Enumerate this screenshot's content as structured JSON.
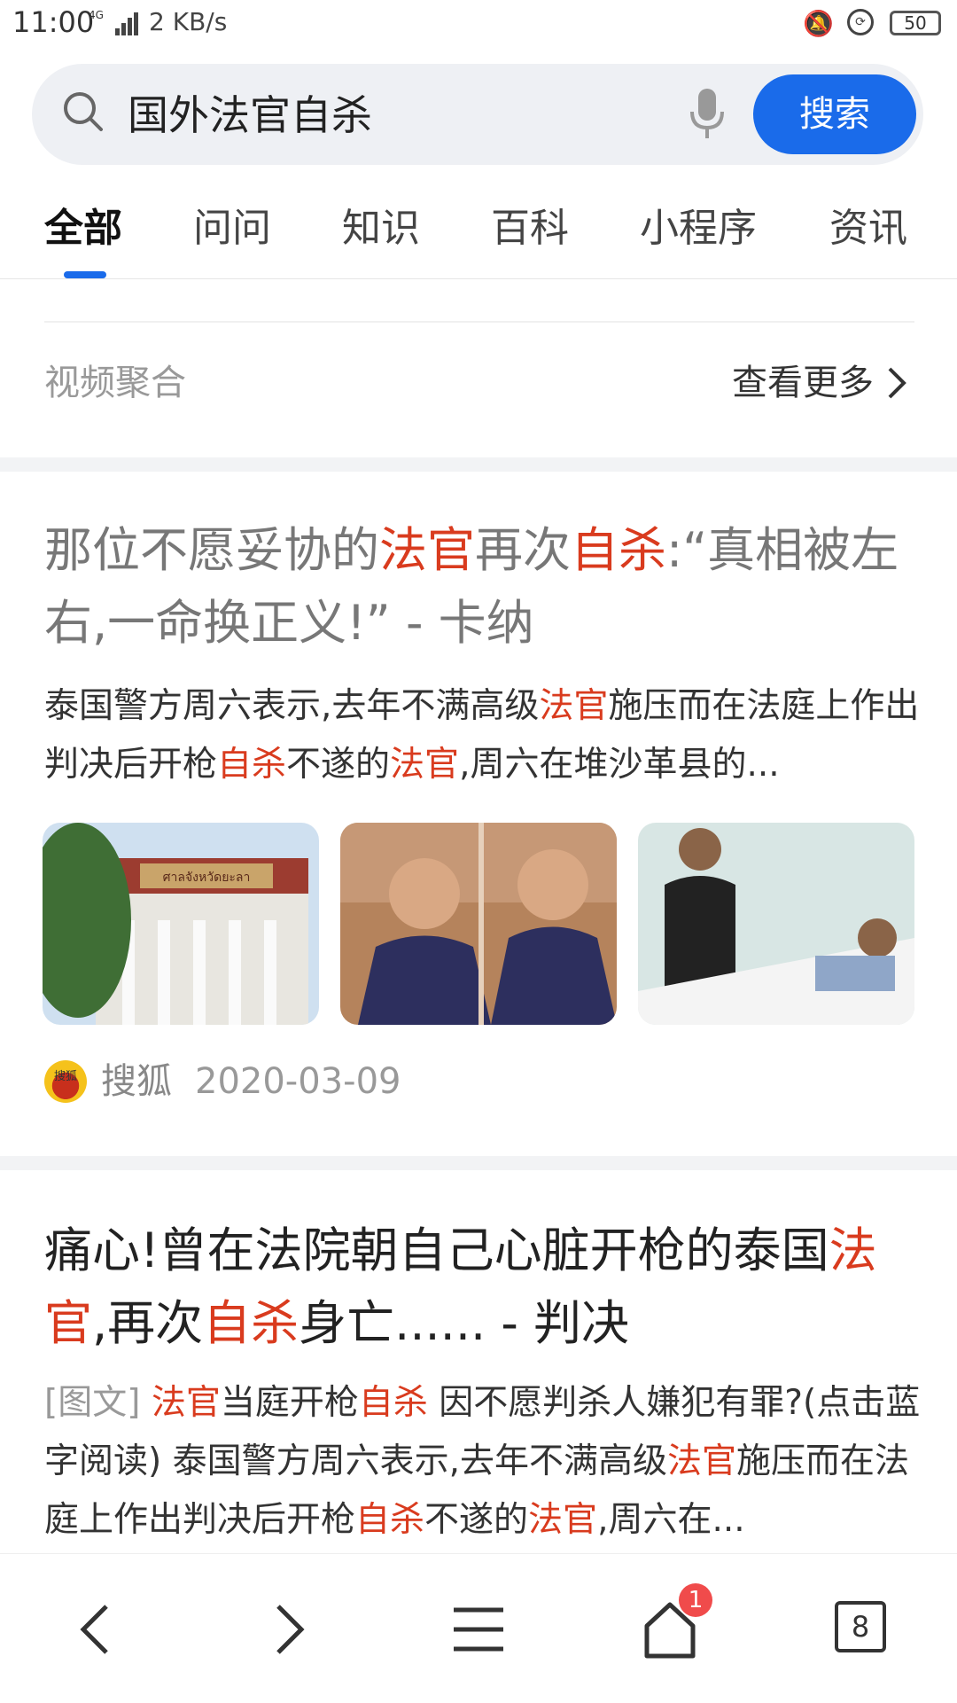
{
  "status_bar": {
    "time": "11:00",
    "network": "4G",
    "speed": "2 KB/s",
    "battery": "50"
  },
  "search": {
    "query": "国外法官自杀",
    "button_label": "搜索"
  },
  "tabs": [
    {
      "label": "全部",
      "active": true
    },
    {
      "label": "问问"
    },
    {
      "label": "知识"
    },
    {
      "label": "百科"
    },
    {
      "label": "小程序"
    },
    {
      "label": "资讯"
    }
  ],
  "video_aggregate": {
    "title": "视频聚合",
    "more_label": "查看更多"
  },
  "results": [
    {
      "title_parts": [
        "那位不愿妥协的",
        "法官",
        "再次",
        "自杀",
        ":“真相被左右,一命换正义!” - 卡纳"
      ],
      "snippet_parts": [
        "泰国警方周六表示,去年不满高级",
        "法官",
        "施压而在法庭上作出判决后开枪",
        "自杀",
        "不遂的",
        "法官",
        ",周六在堆沙革县的..."
      ],
      "thumbnail_sign_text": "ศาลจังหวัดยะลา",
      "source": "搜狐",
      "source_logo_text": "搜狐",
      "date": "2020-03-09"
    },
    {
      "title_parts": [
        "痛心!曾在法院朝自己心脏开枪的泰国",
        "法官",
        ",再次",
        "自杀",
        "身亡...... - 判决"
      ],
      "tag": "[图文]",
      "snippet_parts": [
        "法官",
        "当庭开枪",
        "自杀",
        " 因不愿判杀人嫌犯有罪?(点击蓝字阅读) 泰国警方周六表示,去年不满高级",
        "法官",
        "施压而在法庭上作出判决后开枪",
        "自杀",
        "不遂的",
        "法官",
        ",周六在..."
      ]
    }
  ],
  "bottom_nav": {
    "notification_count": "1",
    "tab_count": "8"
  },
  "colors": {
    "accent": "#1a6bea",
    "highlight": "#d93b1e"
  }
}
